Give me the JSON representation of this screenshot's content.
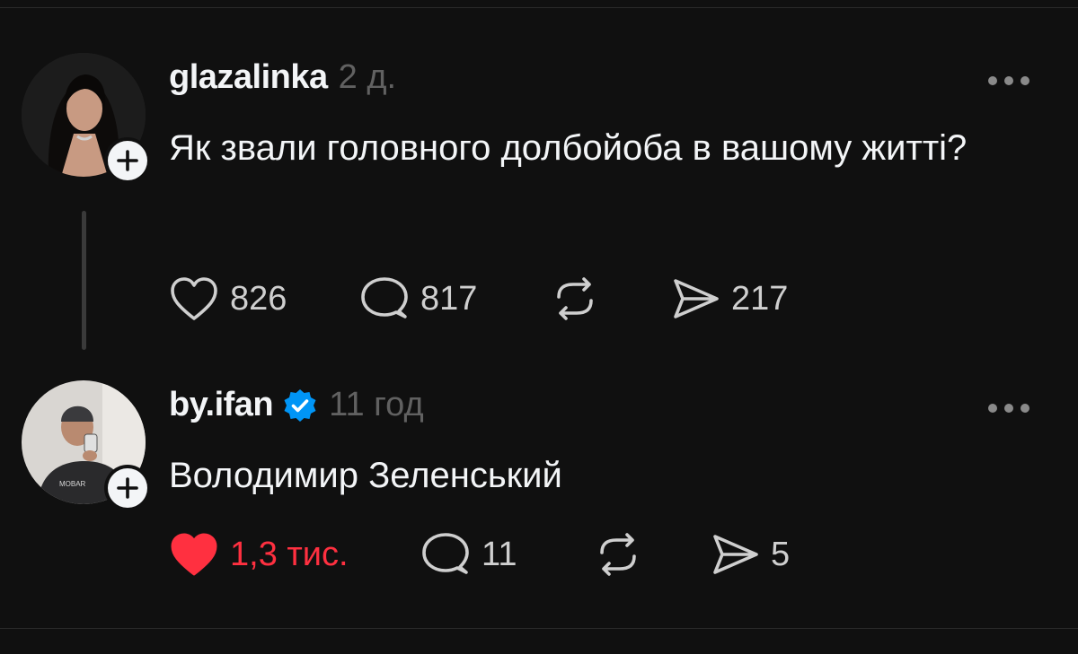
{
  "posts": [
    {
      "username": "glazalinka",
      "verified": false,
      "time": "2 д.",
      "text": "Як звали головного долбойоба в вашому житті?",
      "likes": "826",
      "liked": false,
      "replies": "817",
      "reposts": "",
      "shares": "217"
    },
    {
      "username": "by.ifan",
      "verified": true,
      "time": "11 год",
      "text": "Володимир Зеленський",
      "likes": "1,3 тис.",
      "liked": true,
      "replies": "11",
      "reposts": "",
      "shares": "5"
    }
  ],
  "colors": {
    "background": "#101010",
    "text": "#f3f5f7",
    "muted": "#616161",
    "like_active": "#ff3040",
    "verified": "#0095f6"
  },
  "icons": {
    "like": "heart-icon",
    "reply": "comment-icon",
    "repost": "repost-icon",
    "share": "send-icon",
    "more": "more-icon",
    "follow": "plus-icon",
    "verified": "verified-badge-icon"
  }
}
